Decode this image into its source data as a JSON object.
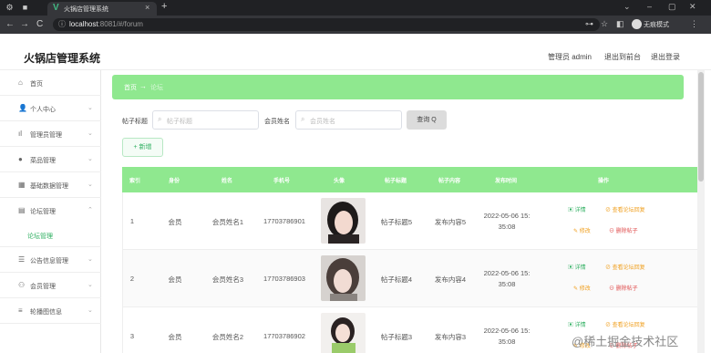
{
  "browser": {
    "tab_title": "火锅店管理系统",
    "url_host": "localhost",
    "url_rest": ":8081/#/forum",
    "incognito_label": "无痕模式"
  },
  "app": {
    "title": "火锅店管理系统",
    "user_label": "管理员 admin",
    "back_label": "退出到前台",
    "logout_label": "退出登录"
  },
  "sidebar": {
    "items": [
      {
        "label": "首页",
        "icon": "home-icon"
      },
      {
        "label": "个人中心",
        "icon": "user-icon"
      },
      {
        "label": "管理员管理",
        "icon": "bar-chart-icon"
      },
      {
        "label": "菜品管理",
        "icon": "dish-icon"
      },
      {
        "label": "基础数据管理",
        "icon": "grid-icon"
      },
      {
        "label": "论坛管理",
        "icon": "forum-icon"
      },
      {
        "label": "公告信息管理",
        "icon": "notice-icon"
      },
      {
        "label": "会员管理",
        "icon": "member-icon"
      },
      {
        "label": "轮播图信息",
        "icon": "list-icon"
      }
    ],
    "active_sub": "论坛管理"
  },
  "breadcrumb": {
    "home": "首页",
    "arrow": "→",
    "current": "论坛"
  },
  "filters": {
    "title_label": "帖子标题",
    "title_placeholder": "帖子标题",
    "name_label": "会员姓名",
    "name_placeholder": "会员姓名",
    "search_label": "查询 Q",
    "add_label": "+ 新增"
  },
  "table": {
    "headers": [
      "索引",
      "身份",
      "姓名",
      "手机号",
      "头像",
      "帖子标题",
      "帖子内容",
      "发布时间",
      "操作"
    ],
    "rows": [
      {
        "index": "1",
        "role": "会员",
        "name": "会员姓名1",
        "phone": "17703786901",
        "title": "帖子标题5",
        "content": "发布内容5",
        "time_date": "2022-05-06 15:",
        "time_clock": "35:08"
      },
      {
        "index": "2",
        "role": "会员",
        "name": "会员姓名3",
        "phone": "17703786903",
        "title": "帖子标题4",
        "content": "发布内容4",
        "time_date": "2022-05-06 15:",
        "time_clock": "35:08"
      },
      {
        "index": "3",
        "role": "会员",
        "name": "会员姓名2",
        "phone": "17703786902",
        "title": "帖子标题3",
        "content": "发布内容3",
        "time_date": "2022-05-06 15:",
        "time_clock": "35:08"
      }
    ],
    "ops": {
      "detail": "详情",
      "reply": "查看论坛回复",
      "edit": "修改",
      "delete": "删除帖子"
    }
  },
  "watermark": "@稀土掘金技术社区",
  "colors": {
    "accent": "#8fe88f",
    "primary_text": "#2eaf60"
  }
}
